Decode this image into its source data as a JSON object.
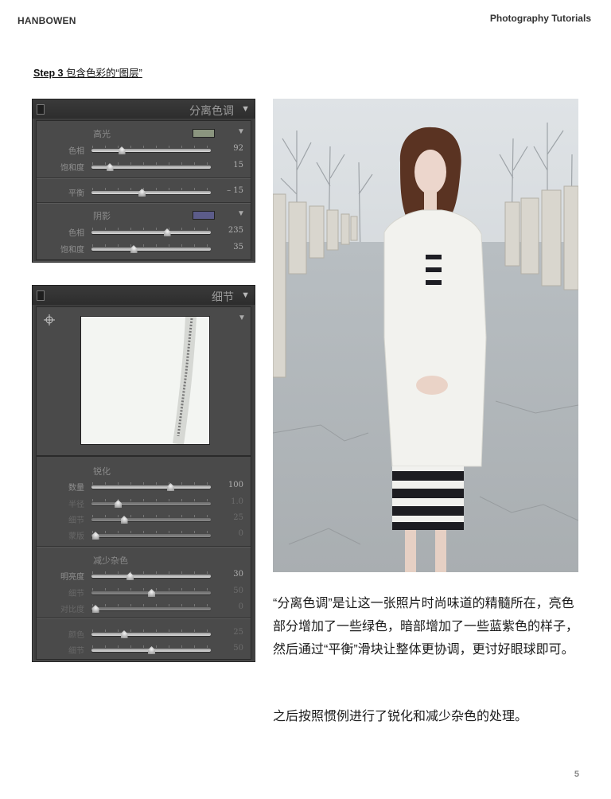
{
  "header": {
    "brand": "HANBOWEN",
    "section": "Photography Tutorials"
  },
  "step": {
    "label": "Step 3",
    "title": "包含色彩的“图层”"
  },
  "split_panel": {
    "title": "分离色调",
    "highlights": {
      "heading": "高光",
      "swatch_color": "#8b957f",
      "rows": [
        {
          "label": "色相",
          "value": "92",
          "position": 0.25
        },
        {
          "label": "饱和度",
          "value": "15",
          "position": 0.15
        }
      ]
    },
    "balance": {
      "label": "平衡",
      "value": "– 15",
      "position": 0.42
    },
    "shadows": {
      "heading": "阴影",
      "swatch_color": "#5c5c8a",
      "rows": [
        {
          "label": "色相",
          "value": "235",
          "position": 0.63
        },
        {
          "label": "饱和度",
          "value": "35",
          "position": 0.35
        }
      ]
    }
  },
  "detail_panel": {
    "title": "细节",
    "sharpen": {
      "heading": "锐化",
      "rows": [
        {
          "label": "数量",
          "value": "100",
          "position": 0.66,
          "dim": false
        },
        {
          "label": "半径",
          "value": "1.0",
          "position": 0.22,
          "dim": true
        },
        {
          "label": "细节",
          "value": "25",
          "position": 0.27,
          "dim": true
        },
        {
          "label": "蒙版",
          "value": "0",
          "position": 0.03,
          "dim": true
        }
      ]
    },
    "noise": {
      "heading": "减少杂色",
      "rows": [
        {
          "label": "明亮度",
          "value": "30",
          "position": 0.32,
          "dim": false
        },
        {
          "label": "细节",
          "value": "50",
          "position": 0.5,
          "dim": true
        },
        {
          "label": "对比度",
          "value": "0",
          "position": 0.03,
          "dim": true
        }
      ],
      "color_rows": [
        {
          "label": "颜色",
          "value": "25",
          "position": 0.27,
          "dim": true
        },
        {
          "label": "细节",
          "value": "50",
          "position": 0.5,
          "dim": true
        }
      ]
    }
  },
  "text": {
    "paragraph1": "“分离色调”是让这一张照片时尚味道的精髓所在，亮色部分增加了一些绿色，暗部增加了一些蓝紫色的样子，然后通过“平衡”滑块让整体更协调，更讨好眼球即可。",
    "paragraph2": "之后按照惯例进行了锐化和减少杂色的处理。"
  },
  "page_number": "5"
}
